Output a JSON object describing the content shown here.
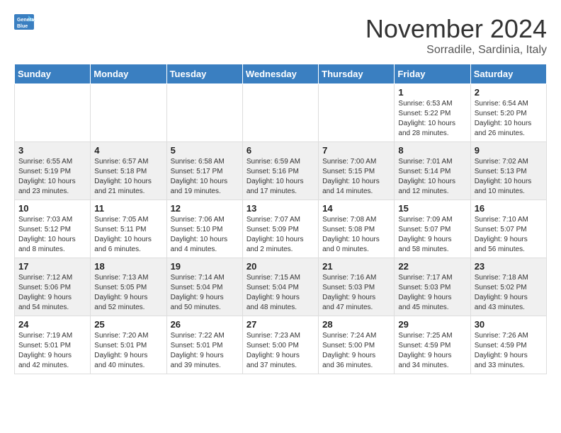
{
  "logo": {
    "line1": "General",
    "line2": "Blue"
  },
  "title": "November 2024",
  "subtitle": "Sorradile, Sardinia, Italy",
  "days_header": [
    "Sunday",
    "Monday",
    "Tuesday",
    "Wednesday",
    "Thursday",
    "Friday",
    "Saturday"
  ],
  "weeks": [
    [
      {
        "day": "",
        "content": ""
      },
      {
        "day": "",
        "content": ""
      },
      {
        "day": "",
        "content": ""
      },
      {
        "day": "",
        "content": ""
      },
      {
        "day": "",
        "content": ""
      },
      {
        "day": "1",
        "content": "Sunrise: 6:53 AM\nSunset: 5:22 PM\nDaylight: 10 hours\nand 28 minutes."
      },
      {
        "day": "2",
        "content": "Sunrise: 6:54 AM\nSunset: 5:20 PM\nDaylight: 10 hours\nand 26 minutes."
      }
    ],
    [
      {
        "day": "3",
        "content": "Sunrise: 6:55 AM\nSunset: 5:19 PM\nDaylight: 10 hours\nand 23 minutes."
      },
      {
        "day": "4",
        "content": "Sunrise: 6:57 AM\nSunset: 5:18 PM\nDaylight: 10 hours\nand 21 minutes."
      },
      {
        "day": "5",
        "content": "Sunrise: 6:58 AM\nSunset: 5:17 PM\nDaylight: 10 hours\nand 19 minutes."
      },
      {
        "day": "6",
        "content": "Sunrise: 6:59 AM\nSunset: 5:16 PM\nDaylight: 10 hours\nand 17 minutes."
      },
      {
        "day": "7",
        "content": "Sunrise: 7:00 AM\nSunset: 5:15 PM\nDaylight: 10 hours\nand 14 minutes."
      },
      {
        "day": "8",
        "content": "Sunrise: 7:01 AM\nSunset: 5:14 PM\nDaylight: 10 hours\nand 12 minutes."
      },
      {
        "day": "9",
        "content": "Sunrise: 7:02 AM\nSunset: 5:13 PM\nDaylight: 10 hours\nand 10 minutes."
      }
    ],
    [
      {
        "day": "10",
        "content": "Sunrise: 7:03 AM\nSunset: 5:12 PM\nDaylight: 10 hours\nand 8 minutes."
      },
      {
        "day": "11",
        "content": "Sunrise: 7:05 AM\nSunset: 5:11 PM\nDaylight: 10 hours\nand 6 minutes."
      },
      {
        "day": "12",
        "content": "Sunrise: 7:06 AM\nSunset: 5:10 PM\nDaylight: 10 hours\nand 4 minutes."
      },
      {
        "day": "13",
        "content": "Sunrise: 7:07 AM\nSunset: 5:09 PM\nDaylight: 10 hours\nand 2 minutes."
      },
      {
        "day": "14",
        "content": "Sunrise: 7:08 AM\nSunset: 5:08 PM\nDaylight: 10 hours\nand 0 minutes."
      },
      {
        "day": "15",
        "content": "Sunrise: 7:09 AM\nSunset: 5:07 PM\nDaylight: 9 hours\nand 58 minutes."
      },
      {
        "day": "16",
        "content": "Sunrise: 7:10 AM\nSunset: 5:07 PM\nDaylight: 9 hours\nand 56 minutes."
      }
    ],
    [
      {
        "day": "17",
        "content": "Sunrise: 7:12 AM\nSunset: 5:06 PM\nDaylight: 9 hours\nand 54 minutes."
      },
      {
        "day": "18",
        "content": "Sunrise: 7:13 AM\nSunset: 5:05 PM\nDaylight: 9 hours\nand 52 minutes."
      },
      {
        "day": "19",
        "content": "Sunrise: 7:14 AM\nSunset: 5:04 PM\nDaylight: 9 hours\nand 50 minutes."
      },
      {
        "day": "20",
        "content": "Sunrise: 7:15 AM\nSunset: 5:04 PM\nDaylight: 9 hours\nand 48 minutes."
      },
      {
        "day": "21",
        "content": "Sunrise: 7:16 AM\nSunset: 5:03 PM\nDaylight: 9 hours\nand 47 minutes."
      },
      {
        "day": "22",
        "content": "Sunrise: 7:17 AM\nSunset: 5:03 PM\nDaylight: 9 hours\nand 45 minutes."
      },
      {
        "day": "23",
        "content": "Sunrise: 7:18 AM\nSunset: 5:02 PM\nDaylight: 9 hours\nand 43 minutes."
      }
    ],
    [
      {
        "day": "24",
        "content": "Sunrise: 7:19 AM\nSunset: 5:01 PM\nDaylight: 9 hours\nand 42 minutes."
      },
      {
        "day": "25",
        "content": "Sunrise: 7:20 AM\nSunset: 5:01 PM\nDaylight: 9 hours\nand 40 minutes."
      },
      {
        "day": "26",
        "content": "Sunrise: 7:22 AM\nSunset: 5:01 PM\nDaylight: 9 hours\nand 39 minutes."
      },
      {
        "day": "27",
        "content": "Sunrise: 7:23 AM\nSunset: 5:00 PM\nDaylight: 9 hours\nand 37 minutes."
      },
      {
        "day": "28",
        "content": "Sunrise: 7:24 AM\nSunset: 5:00 PM\nDaylight: 9 hours\nand 36 minutes."
      },
      {
        "day": "29",
        "content": "Sunrise: 7:25 AM\nSunset: 4:59 PM\nDaylight: 9 hours\nand 34 minutes."
      },
      {
        "day": "30",
        "content": "Sunrise: 7:26 AM\nSunset: 4:59 PM\nDaylight: 9 hours\nand 33 minutes."
      }
    ]
  ]
}
